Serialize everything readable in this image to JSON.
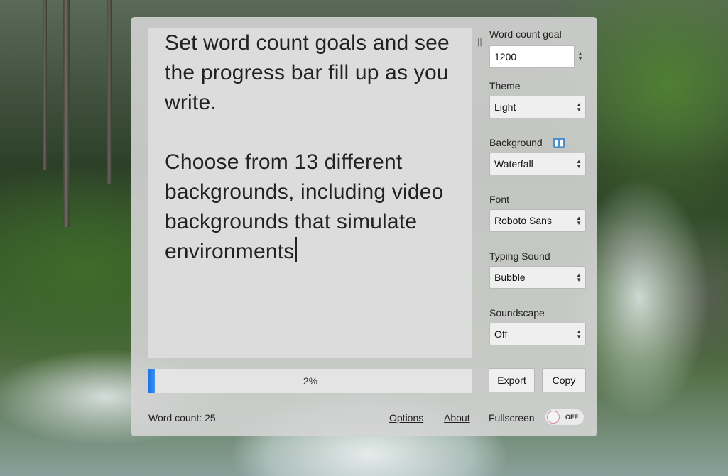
{
  "editor": {
    "paragraphs": [
      "Set word count goals and see the progress bar fill up as you write.",
      "Choose from 13 different backgrounds, including video backgrounds that simulate environments"
    ]
  },
  "controls": {
    "word_goal": {
      "label": "Word count goal",
      "value": "1200"
    },
    "theme": {
      "label": "Theme",
      "value": "Light"
    },
    "background": {
      "label": "Background",
      "value": "Waterfall",
      "pause_icon": "pause-icon"
    },
    "font": {
      "label": "Font",
      "value": "Roboto Sans"
    },
    "typing_sound": {
      "label": "Typing Sound",
      "value": "Bubble"
    },
    "soundscape": {
      "label": "Soundscape",
      "value": "Off"
    }
  },
  "progress": {
    "percent": 2,
    "label": "2%",
    "color": "#1a73e8"
  },
  "buttons": {
    "export": "Export",
    "copy": "Copy"
  },
  "footer": {
    "word_count": "Word count: 25",
    "options": "Options",
    "about": "About",
    "fullscreen": "Fullscreen",
    "fullscreen_state": "OFF"
  },
  "icons": {
    "resize_handle": "drag-handle-icon",
    "select_arrows": "select-arrows-icon"
  }
}
